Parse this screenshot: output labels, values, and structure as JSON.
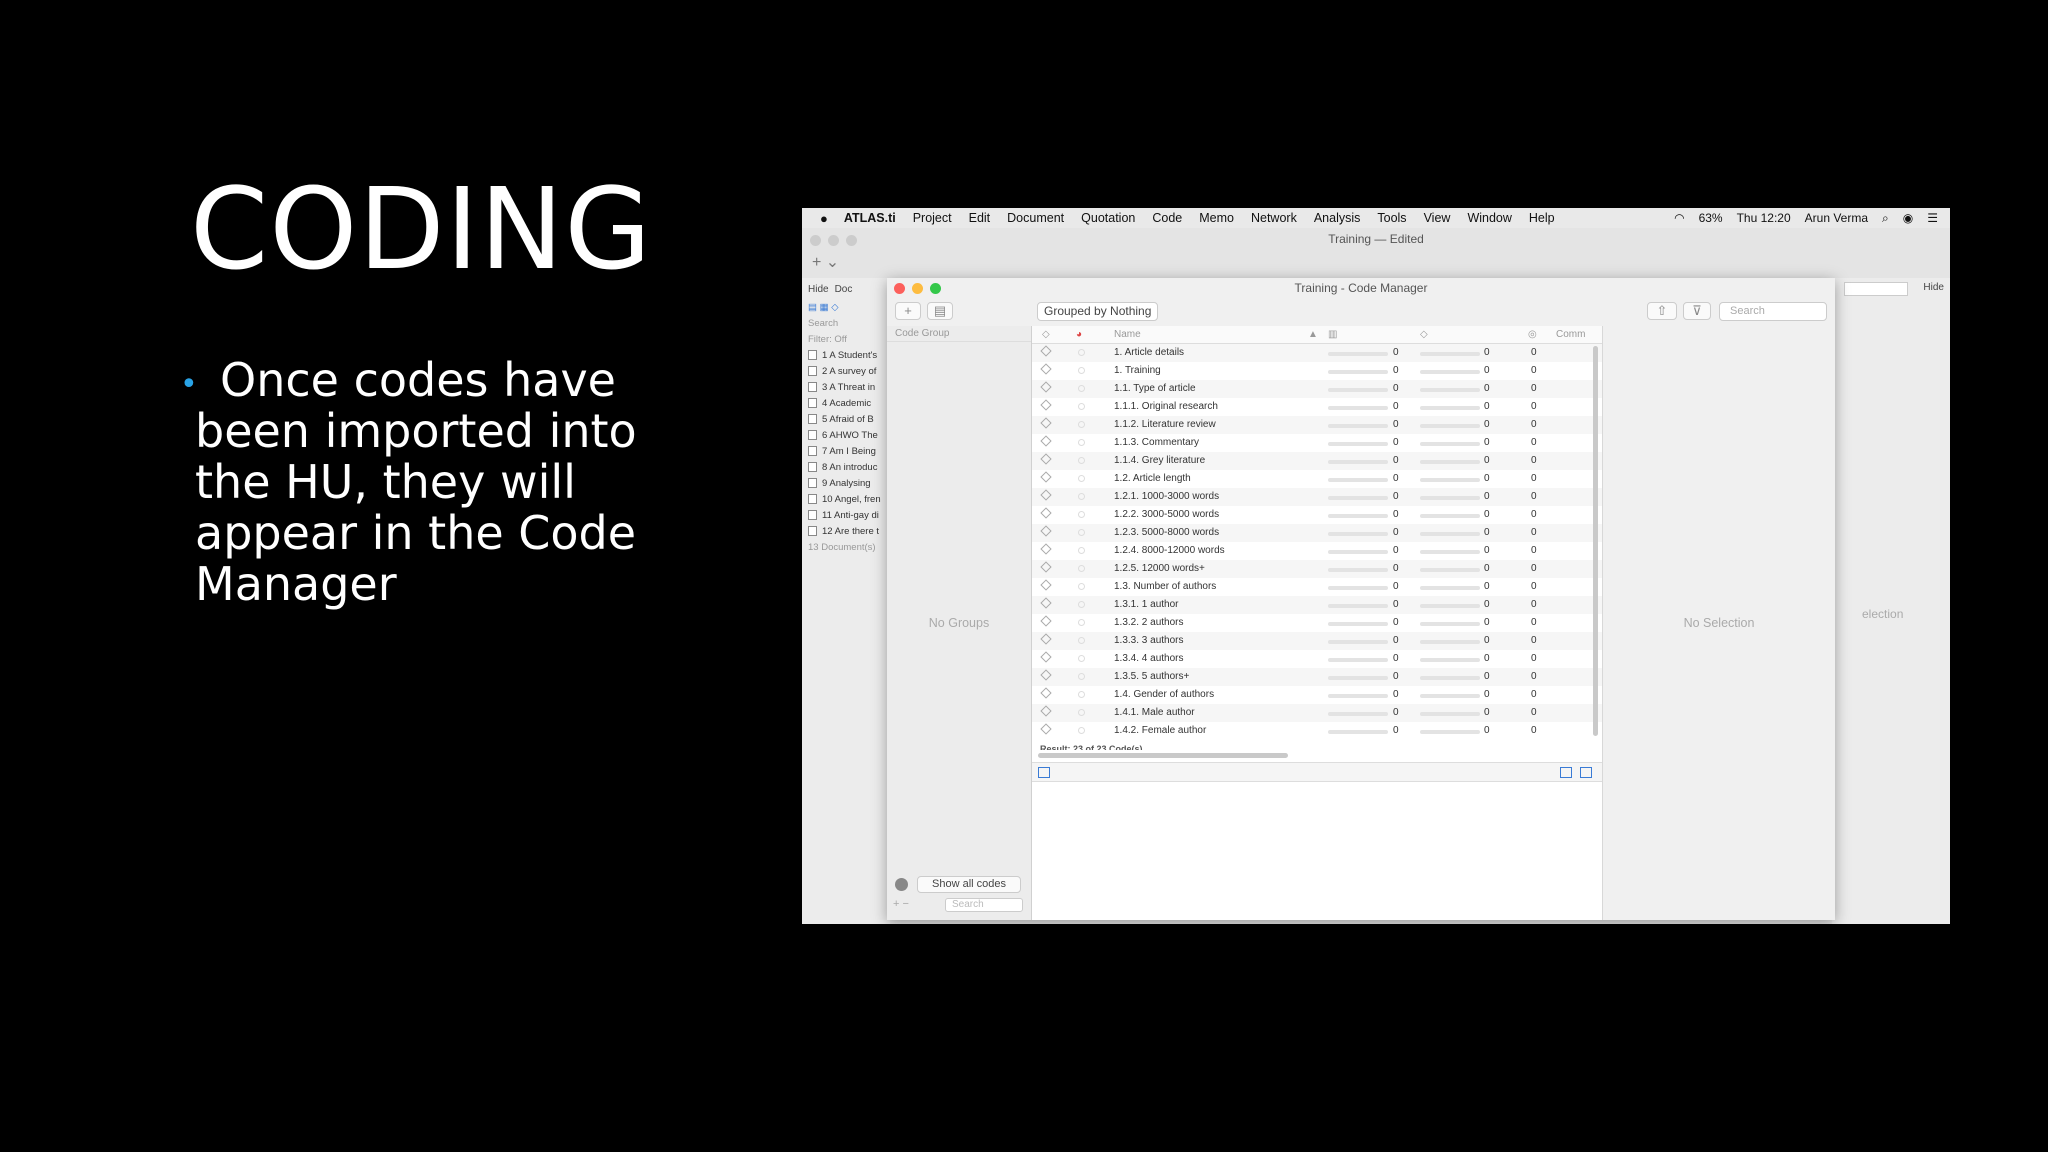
{
  "slide": {
    "title": "CODING",
    "bullet": "Once codes have been imported into the HU, they will appear in the Code Manager"
  },
  "menubar": {
    "apple": "",
    "app": "ATLAS.ti",
    "items": [
      "Project",
      "Edit",
      "Document",
      "Quotation",
      "Code",
      "Memo",
      "Network",
      "Analysis",
      "Tools",
      "View",
      "Window",
      "Help"
    ],
    "battery": "63%",
    "clock": "Thu 12:20",
    "user": "Arun Verma"
  },
  "doc_window": {
    "title": "Training — Edited",
    "hide_left": "Hide",
    "hide_right": "Hide",
    "tab_doc": "Doc",
    "search": "Search",
    "filter": "Filter: Off",
    "documents": [
      "1 A Student's",
      "2 A survey of",
      "3 A Threat in",
      "4 Academic",
      "5 Afraid of B",
      "6 AHWO The",
      "7 Am I Being",
      "8 An introduc",
      "9 Analysing",
      "10 Angel, fren",
      "11 Anti-gay di",
      "12 Are there t"
    ],
    "doc_count": "13 Document(s)",
    "right_selection": "election"
  },
  "code_manager": {
    "title": "Training - Code Manager",
    "grouped_by": "Grouped by Nothing",
    "search_placeholder": "Search",
    "add_label": "+",
    "code_group_header": "Code Group",
    "no_groups": "No Groups",
    "show_all_codes": "Show all codes",
    "groups_search": "Search",
    "columns": {
      "name": "Name",
      "comment": "Comm"
    },
    "no_selection": "No Selection",
    "result": "Result: 23 of 23 Code(s)",
    "codes": [
      {
        "name": "1. Article details",
        "grounded": "0",
        "density": "0",
        "groups": "0"
      },
      {
        "name": "1. Training",
        "grounded": "0",
        "density": "0",
        "groups": "0"
      },
      {
        "name": "1.1. Type of article",
        "grounded": "0",
        "density": "0",
        "groups": "0"
      },
      {
        "name": "1.1.1. Original research",
        "grounded": "0",
        "density": "0",
        "groups": "0"
      },
      {
        "name": "1.1.2. Literature review",
        "grounded": "0",
        "density": "0",
        "groups": "0"
      },
      {
        "name": "1.1.3. Commentary",
        "grounded": "0",
        "density": "0",
        "groups": "0"
      },
      {
        "name": "1.1.4. Grey literature",
        "grounded": "0",
        "density": "0",
        "groups": "0"
      },
      {
        "name": "1.2. Article length",
        "grounded": "0",
        "density": "0",
        "groups": "0"
      },
      {
        "name": "1.2.1. 1000-3000 words",
        "grounded": "0",
        "density": "0",
        "groups": "0"
      },
      {
        "name": "1.2.2. 3000-5000 words",
        "grounded": "0",
        "density": "0",
        "groups": "0"
      },
      {
        "name": "1.2.3. 5000-8000 words",
        "grounded": "0",
        "density": "0",
        "groups": "0"
      },
      {
        "name": "1.2.4. 8000-12000 words",
        "grounded": "0",
        "density": "0",
        "groups": "0"
      },
      {
        "name": "1.2.5. 12000 words+",
        "grounded": "0",
        "density": "0",
        "groups": "0"
      },
      {
        "name": "1.3. Number of authors",
        "grounded": "0",
        "density": "0",
        "groups": "0"
      },
      {
        "name": "1.3.1. 1 author",
        "grounded": "0",
        "density": "0",
        "groups": "0"
      },
      {
        "name": "1.3.2. 2 authors",
        "grounded": "0",
        "density": "0",
        "groups": "0"
      },
      {
        "name": "1.3.3. 3 authors",
        "grounded": "0",
        "density": "0",
        "groups": "0"
      },
      {
        "name": "1.3.4. 4 authors",
        "grounded": "0",
        "density": "0",
        "groups": "0"
      },
      {
        "name": "1.3.5. 5 authors+",
        "grounded": "0",
        "density": "0",
        "groups": "0"
      },
      {
        "name": "1.4. Gender of authors",
        "grounded": "0",
        "density": "0",
        "groups": "0"
      },
      {
        "name": "1.4.1. Male author",
        "grounded": "0",
        "density": "0",
        "groups": "0"
      },
      {
        "name": "1.4.2. Female author",
        "grounded": "0",
        "density": "0",
        "groups": "0"
      }
    ]
  },
  "colors": {
    "bullet": "#29a3e6",
    "close": "#fc605c",
    "minimize": "#fdbc40",
    "zoom": "#34c84a"
  }
}
